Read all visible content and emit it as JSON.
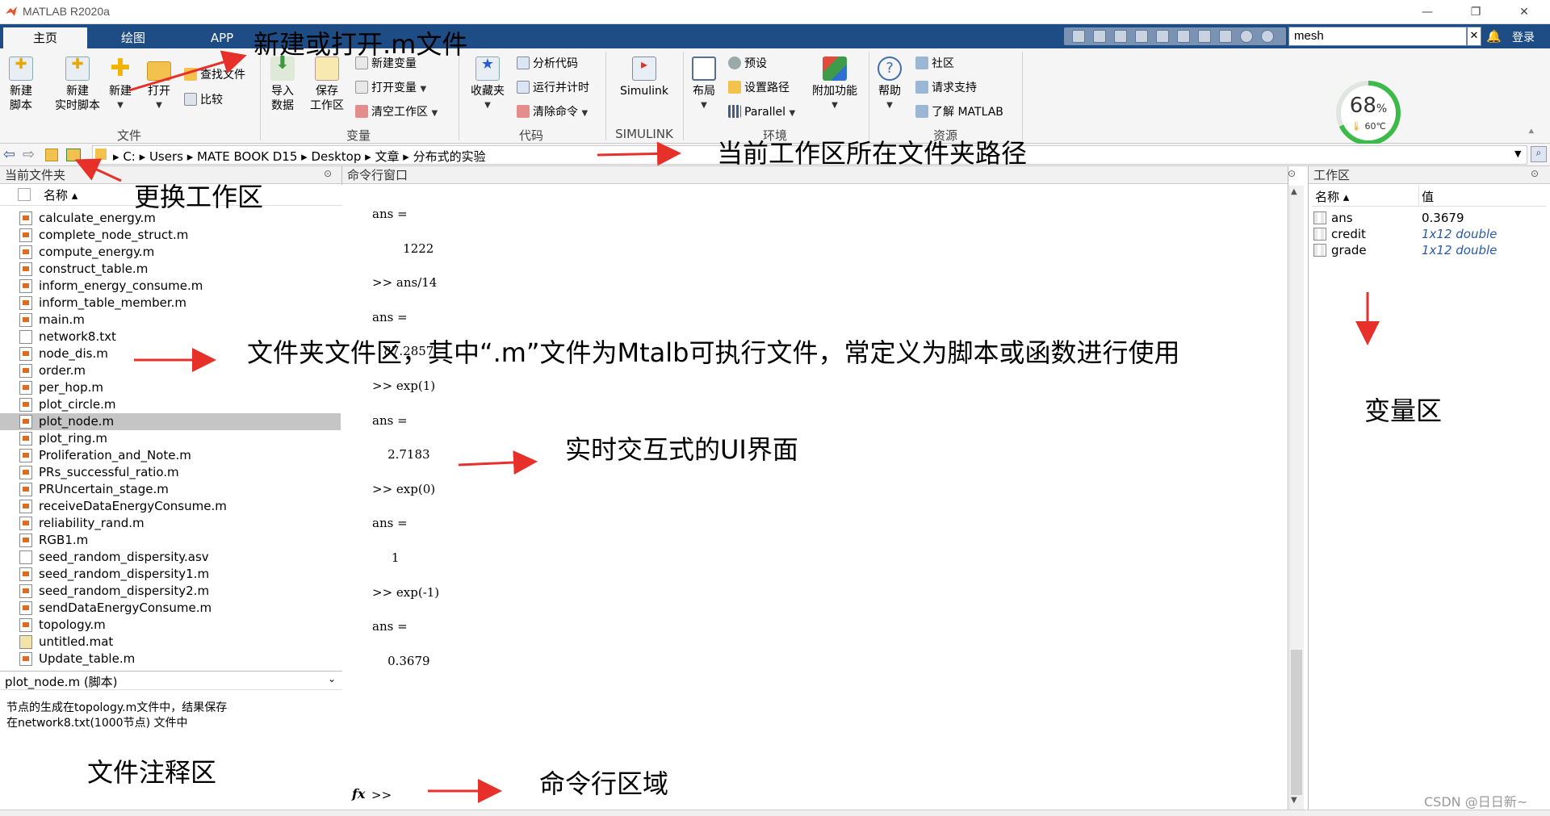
{
  "window": {
    "title": "MATLAB R2020a"
  },
  "tabs": [
    {
      "label": "主页"
    },
    {
      "label": "绘图"
    },
    {
      "label": "APP"
    }
  ],
  "search": {
    "value": "mesh",
    "login": "登录"
  },
  "ribbon": {
    "file_group": {
      "label": "文件",
      "new_script": "新建\n脚本",
      "new_live": "新建\n实时脚本",
      "new": "新建",
      "open": "打开",
      "find_files": "查找文件",
      "compare": "比较"
    },
    "var_group": {
      "label": "变量",
      "import": "导入\n数据",
      "save": "保存\n工作区",
      "new_var": "新建变量",
      "open_var": "打开变量",
      "clear_ws": "清空工作区"
    },
    "code_group": {
      "label": "代码",
      "favorites": "收藏夹",
      "analyze": "分析代码",
      "run_time": "运行并计时",
      "clear_cmd": "清除命令"
    },
    "simulink_group": {
      "label": "SIMULINK",
      "simulink": "Simulink"
    },
    "env_group": {
      "label": "环境",
      "layout": "布局",
      "prefs": "预设",
      "set_path": "设置路径",
      "parallel": "Parallel",
      "addons": "附加功能"
    },
    "res_group": {
      "label": "资源",
      "help": "帮助",
      "community": "社区",
      "support": "请求支持",
      "learn": "了解 MATLAB"
    }
  },
  "gauge": {
    "percent": "68",
    "percent_sign": "%",
    "temp": "60℃",
    "value": 0.68
  },
  "address": {
    "crumbs": [
      "C:",
      "Users",
      "MATE BOOK D15",
      "Desktop",
      "文章",
      "分布式的实验"
    ]
  },
  "file_panel": {
    "title": "当前文件夹",
    "col_name": "名称 ▴",
    "files": [
      {
        "name": "calculate_energy.m",
        "type": "m"
      },
      {
        "name": "complete_node_struct.m",
        "type": "m"
      },
      {
        "name": "compute_energy.m",
        "type": "m"
      },
      {
        "name": "construct_table.m",
        "type": "m"
      },
      {
        "name": "inform_energy_consume.m",
        "type": "m"
      },
      {
        "name": "inform_table_member.m",
        "type": "m"
      },
      {
        "name": "main.m",
        "type": "m"
      },
      {
        "name": "network8.txt",
        "type": "txt"
      },
      {
        "name": "node_dis.m",
        "type": "m"
      },
      {
        "name": "order.m",
        "type": "m"
      },
      {
        "name": "per_hop.m",
        "type": "m"
      },
      {
        "name": "plot_circle.m",
        "type": "m"
      },
      {
        "name": "plot_node.m",
        "type": "m",
        "selected": true
      },
      {
        "name": "plot_ring.m",
        "type": "m"
      },
      {
        "name": "Proliferation_and_Note.m",
        "type": "m"
      },
      {
        "name": "PRs_successful_ratio.m",
        "type": "m"
      },
      {
        "name": "PRUncertain_stage.m",
        "type": "m"
      },
      {
        "name": "receiveDataEnergyConsume.m",
        "type": "m"
      },
      {
        "name": "reliability_rand.m",
        "type": "m"
      },
      {
        "name": "RGB1.m",
        "type": "m"
      },
      {
        "name": "seed_random_dispersity.asv",
        "type": "txt"
      },
      {
        "name": "seed_random_dispersity1.m",
        "type": "m"
      },
      {
        "name": "seed_random_dispersity2.m",
        "type": "m"
      },
      {
        "name": "sendDataEnergyConsume.m",
        "type": "m"
      },
      {
        "name": "topology.m",
        "type": "m"
      },
      {
        "name": "untitled.mat",
        "type": "mat"
      },
      {
        "name": "Update_table.m",
        "type": "m"
      }
    ],
    "detail_title": "plot_node.m  (脚本)",
    "detail_text": "节点的生成在topology.m文件中，结果保存\n在network8.txt(1000节点) 文件中"
  },
  "command_window": {
    "title": "命令行窗口",
    "lines": [
      "ans =",
      "",
      "        1222",
      "",
      ">> ans/14",
      "",
      "ans =",
      "",
      "   87.2857",
      "",
      ">> exp(1)",
      "",
      "ans =",
      "",
      "    2.7183",
      "",
      ">> exp(0)",
      "",
      "ans =",
      "",
      "     1",
      "",
      ">> exp(-1)",
      "",
      "ans =",
      "",
      "    0.3679"
    ],
    "fx": "fx",
    "prompt": ">>"
  },
  "workspace": {
    "title": "工作区",
    "col_name": "名称 ▴",
    "col_value": "值",
    "vars": [
      {
        "name": "ans",
        "value": "0.3679",
        "italic": false
      },
      {
        "name": "credit",
        "value": "1x12 double",
        "italic": true
      },
      {
        "name": "grade",
        "value": "1x12 double",
        "italic": true
      }
    ]
  },
  "annotations": {
    "new_open": "新建或打开.m文件",
    "path": "当前工作区所在文件夹路径",
    "change_ws": "更换工作区",
    "folder_area": "文件夹文件区，其中“.m”文件为Mtalb可执行文件，常定义为脚本或函数进行使用",
    "ui": "实时交互式的UI界面",
    "var_area": "变量区",
    "notes_area": "文件注释区",
    "cmd_area": "命令行区域"
  },
  "watermark": "CSDN @日日新~",
  "colors": {
    "tabbar": "#1d4d84",
    "arrow": "#e8302a",
    "gauge": "#3dbb4a"
  }
}
